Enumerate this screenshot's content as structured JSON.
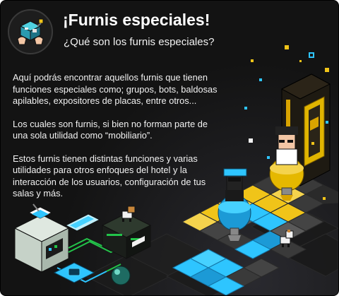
{
  "header": {
    "title": "¡Furnis especiales!",
    "subtitle": "¿Qué son los furnis especiales?",
    "icon": "furni-box-icon"
  },
  "body": {
    "paragraphs": [
      "Aquí podrás encontrar aquellos furnis que tienen funciones especiales como; grupos, bots, baldosas apilables, expositores de placas, entre otros...",
      "Los cuales son furnis, si bien no forman parte de una sola utilidad como “mobiliario”.",
      "Estos furnis tienen distintas funciones y varias utilidades para otros enfoques del hotel y la interacción de los usuarios, configuración de tus salas y más."
    ]
  },
  "colors": {
    "background": "#131313",
    "text": "#ffffff",
    "neon_blue": "#2ec5ff",
    "neon_green": "#23c44a",
    "gold": "#d9a400",
    "yellow_tile": "#f0c419"
  }
}
